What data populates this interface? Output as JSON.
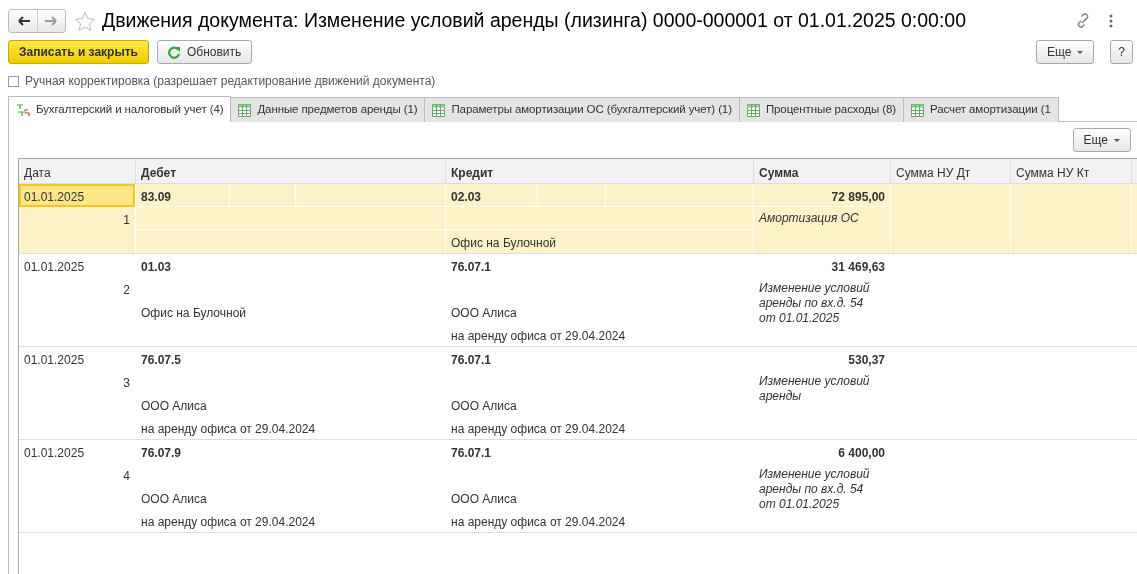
{
  "window": {
    "title": "Движения документа: Изменение условий аренды (лизинга) 0000-000001 от 01.01.2025 0:00:00"
  },
  "toolbar": {
    "primary_button": "Записать и закрыть",
    "refresh_button": "Обновить",
    "more_button": "Еще",
    "help_button": "?"
  },
  "manual_edit": {
    "label": "Ручная корректировка (разрешает редактирование движений документа)",
    "checked": false
  },
  "tabs": [
    {
      "label": "Бухгалтерский и налоговый учет (4)",
      "kind": "ledger",
      "selected": true
    },
    {
      "label": "Данные предметов аренды (1)",
      "kind": "register",
      "selected": false
    },
    {
      "label": "Параметры амортизации ОС (бухгалтерский учет) (1)",
      "kind": "register",
      "selected": false
    },
    {
      "label": "Процентные расходы (8)",
      "kind": "register",
      "selected": false
    },
    {
      "label": "Расчет амортизации (1",
      "kind": "register",
      "selected": false
    }
  ],
  "table_toolbar": {
    "more_button": "Еще"
  },
  "table": {
    "columns": [
      "Дата",
      "Дебет",
      "Кредит",
      "Сумма",
      "Сумма НУ Дт",
      "Сумма НУ Кт"
    ],
    "rows": [
      {
        "date": "01.01.2025",
        "number": "1",
        "selected": true,
        "debit": {
          "account": "83.09"
        },
        "credit": {
          "account": "02.03",
          "subconto_2": "Офис на Булочной"
        },
        "sum": "72 895,00",
        "content": "Амортизация ОС"
      },
      {
        "date": "01.01.2025",
        "number": "2",
        "selected": false,
        "debit": {
          "account": "01.03",
          "subconto_2": "Офис на Булочной"
        },
        "credit": {
          "account": "76.07.1",
          "subconto_2": "ООО Алиса",
          "subconto_3": "на аренду офиса от 29.04.2024"
        },
        "sum": "31 469,63",
        "content": "Изменение условий аренды по вх.д. 54 от 01.01.2025"
      },
      {
        "date": "01.01.2025",
        "number": "3",
        "selected": false,
        "debit": {
          "account": "76.07.5",
          "subconto_2": "ООО Алиса",
          "subconto_3": "на аренду офиса от 29.04.2024"
        },
        "credit": {
          "account": "76.07.1",
          "subconto_2": "ООО Алиса",
          "subconto_3": "на аренду офиса от 29.04.2024"
        },
        "sum": "530,37",
        "content": "Изменение условий аренды"
      },
      {
        "date": "01.01.2025",
        "number": "4",
        "selected": false,
        "debit": {
          "account": "76.07.9",
          "subconto_2": "ООО Алиса",
          "subconto_3": "на аренду офиса от 29.04.2024"
        },
        "credit": {
          "account": "76.07.1",
          "subconto_2": "ООО Алиса",
          "subconto_3": "на аренду офиса от 29.04.2024"
        },
        "sum": "6 400,00",
        "content": "Изменение условий аренды по вх.д. 54 от 01.01.2025"
      }
    ]
  }
}
